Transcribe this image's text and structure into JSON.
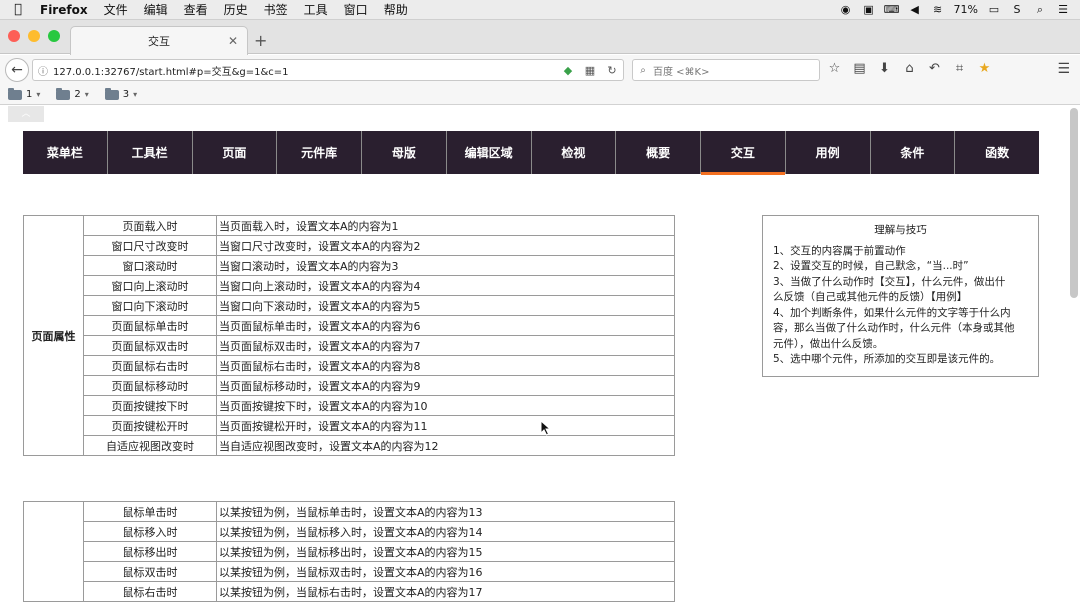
{
  "menubar": {
    "app": "Firefox",
    "items": [
      "文件",
      "编辑",
      "查看",
      "历史",
      "书签",
      "工具",
      "窗口",
      "帮助"
    ],
    "battery": "71%"
  },
  "tab": {
    "title": "交互"
  },
  "navbar": {
    "url": "127.0.0.1:32767/start.html#p=交互&g=1&c=1",
    "search_placeholder": "百度 <⌘K>"
  },
  "bookmarks": [
    "1",
    "2",
    "3"
  ],
  "nav_menu": {
    "items": [
      "菜单栏",
      "工具栏",
      "页面",
      "元件库",
      "母版",
      "编辑区域",
      "检视",
      "概要",
      "交互",
      "用例",
      "条件",
      "函数"
    ],
    "active": "交互"
  },
  "table1": {
    "group": "页面属性",
    "rows": [
      {
        "event": "页面载入时",
        "desc": "当页面载入时，设置文本A的内容为1"
      },
      {
        "event": "窗口尺寸改变时",
        "desc": "当窗口尺寸改变时，设置文本A的内容为2"
      },
      {
        "event": "窗口滚动时",
        "desc": "当窗口滚动时，设置文本A的内容为3"
      },
      {
        "event": "窗口向上滚动时",
        "desc": "当窗口向上滚动时，设置文本A的内容为4"
      },
      {
        "event": "窗口向下滚动时",
        "desc": "当窗口向下滚动时，设置文本A的内容为5"
      },
      {
        "event": "页面鼠标单击时",
        "desc": "当页面鼠标单击时，设置文本A的内容为6"
      },
      {
        "event": "页面鼠标双击时",
        "desc": "当页面鼠标双击时，设置文本A的内容为7"
      },
      {
        "event": "页面鼠标右击时",
        "desc": "当页面鼠标右击时，设置文本A的内容为8"
      },
      {
        "event": "页面鼠标移动时",
        "desc": "当页面鼠标移动时，设置文本A的内容为9"
      },
      {
        "event": "页面按键按下时",
        "desc": "当页面按键按下时，设置文本A的内容为10"
      },
      {
        "event": "页面按键松开时",
        "desc": "当页面按键松开时，设置文本A的内容为11"
      },
      {
        "event": "自适应视图改变时",
        "desc": "当自适应视图改变时，设置文本A的内容为12"
      }
    ]
  },
  "table2": {
    "group": "",
    "rows": [
      {
        "event": "鼠标单击时",
        "desc": "以某按钮为例，当鼠标单击时，设置文本A的内容为13"
      },
      {
        "event": "鼠标移入时",
        "desc": "以某按钮为例，当鼠标移入时，设置文本A的内容为14"
      },
      {
        "event": "鼠标移出时",
        "desc": "以某按钮为例，当鼠标移出时，设置文本A的内容为15"
      },
      {
        "event": "鼠标双击时",
        "desc": "以某按钮为例，当鼠标双击时，设置文本A的内容为16"
      },
      {
        "event": "鼠标右击时",
        "desc": "以某按钮为例，当鼠标右击时，设置文本A的内容为17"
      }
    ]
  },
  "tips": {
    "title": "理解与技巧",
    "lines": [
      "1、交互的内容属于前置动作",
      "2、设置交互的时候，自己默念，“当...时”",
      "3、当做了什么动作时【交互】，什么元件，做出什",
      "么反馈（自己或其他元件的反馈）【用例】",
      "4、加个判断条件，如果什么元件的文字等于什么内",
      "容，那么当做了什么动作时，什么元件（本身或其他",
      "元件），做出什么反馈。",
      "5、选中哪个元件，所添加的交互即是该元件的。"
    ]
  }
}
